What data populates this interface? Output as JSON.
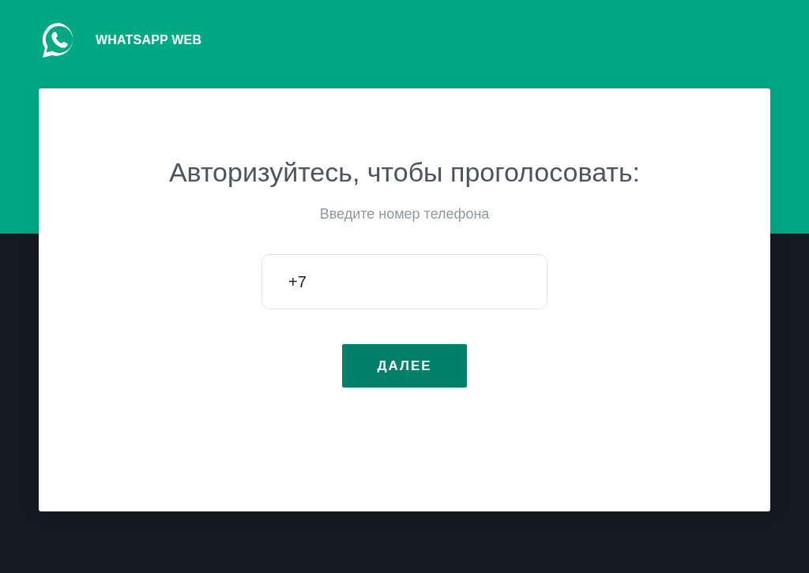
{
  "header": {
    "title": "WHATSAPP WEB"
  },
  "card": {
    "heading": "Авторизуйтесь, чтобы проголосовать:",
    "subtitle": "Введите номер телефона",
    "phone_field": {
      "value": "+7"
    },
    "button": "ДАЛЕЕ"
  }
}
